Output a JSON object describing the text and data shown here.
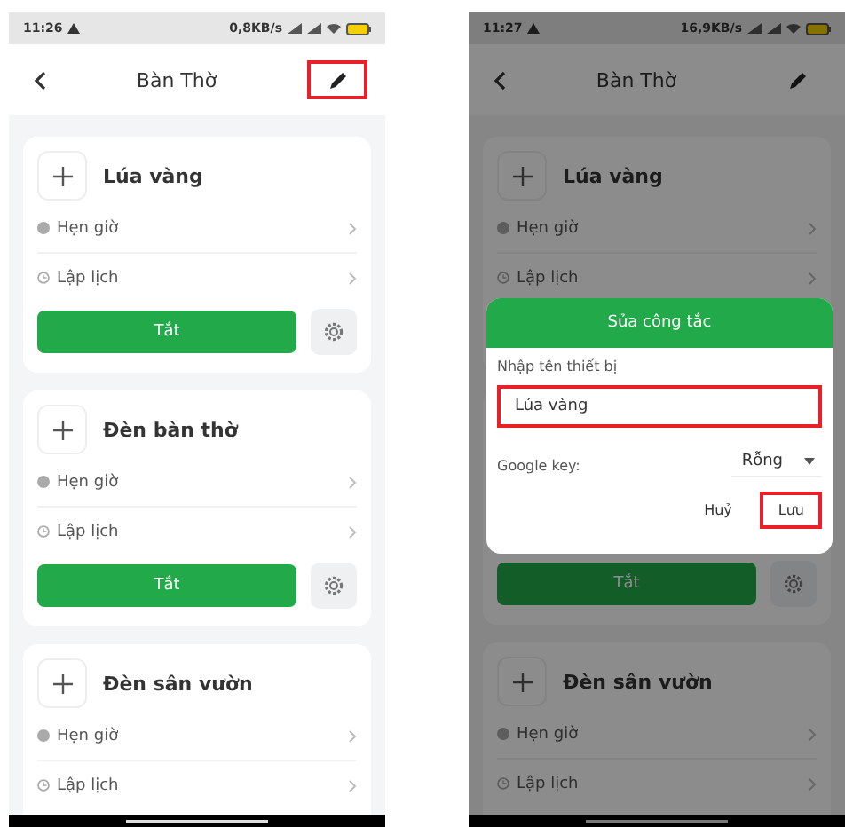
{
  "screens": [
    {
      "status_bar": {
        "time": "11:26",
        "speed": "0,8KB/s"
      },
      "header": {
        "title": "Bàn Thờ",
        "edit_highlighted": true
      },
      "dimmed": false,
      "devices": [
        {
          "name": "Lúa vàng",
          "rows": [
            {
              "kind": "timer",
              "label": "Hẹn giờ"
            },
            {
              "kind": "schedule",
              "label": "Lập lịch"
            }
          ],
          "button": "Tắt"
        },
        {
          "name": "Đèn bàn thờ",
          "rows": [
            {
              "kind": "timer",
              "label": "Hẹn giờ"
            },
            {
              "kind": "schedule",
              "label": "Lập lịch"
            }
          ],
          "button": "Tắt"
        },
        {
          "name": "Đèn sân vườn",
          "rows": [
            {
              "kind": "timer",
              "label": "Hẹn giờ"
            },
            {
              "kind": "schedule",
              "label": "Lập lịch"
            }
          ]
        }
      ]
    },
    {
      "status_bar": {
        "time": "11:27",
        "speed": "16,9KB/s"
      },
      "header": {
        "title": "Bàn Thờ",
        "edit_highlighted": false
      },
      "dimmed": true,
      "devices": [
        {
          "name": "Lúa vàng",
          "rows": [
            {
              "kind": "timer",
              "label": "Hẹn giờ"
            },
            {
              "kind": "schedule",
              "label": "Lập lịch"
            }
          ]
        },
        {
          "button": "Tắt"
        },
        {
          "name": "Đèn sân vườn",
          "rows": [
            {
              "kind": "timer",
              "label": "Hẹn giờ"
            },
            {
              "kind": "schedule",
              "label": "Lập lịch"
            }
          ]
        }
      ],
      "dialog": {
        "title": "Sửa công tắc",
        "field_label": "Nhập tên thiết bị",
        "field_value": "Lúa vàng",
        "field_highlighted": true,
        "key_label": "Google key:",
        "key_value": "Rỗng",
        "buttons": [
          {
            "label": "Huỷ",
            "highlighted": false
          },
          {
            "label": "Lưu",
            "highlighted": true
          }
        ]
      }
    }
  ]
}
